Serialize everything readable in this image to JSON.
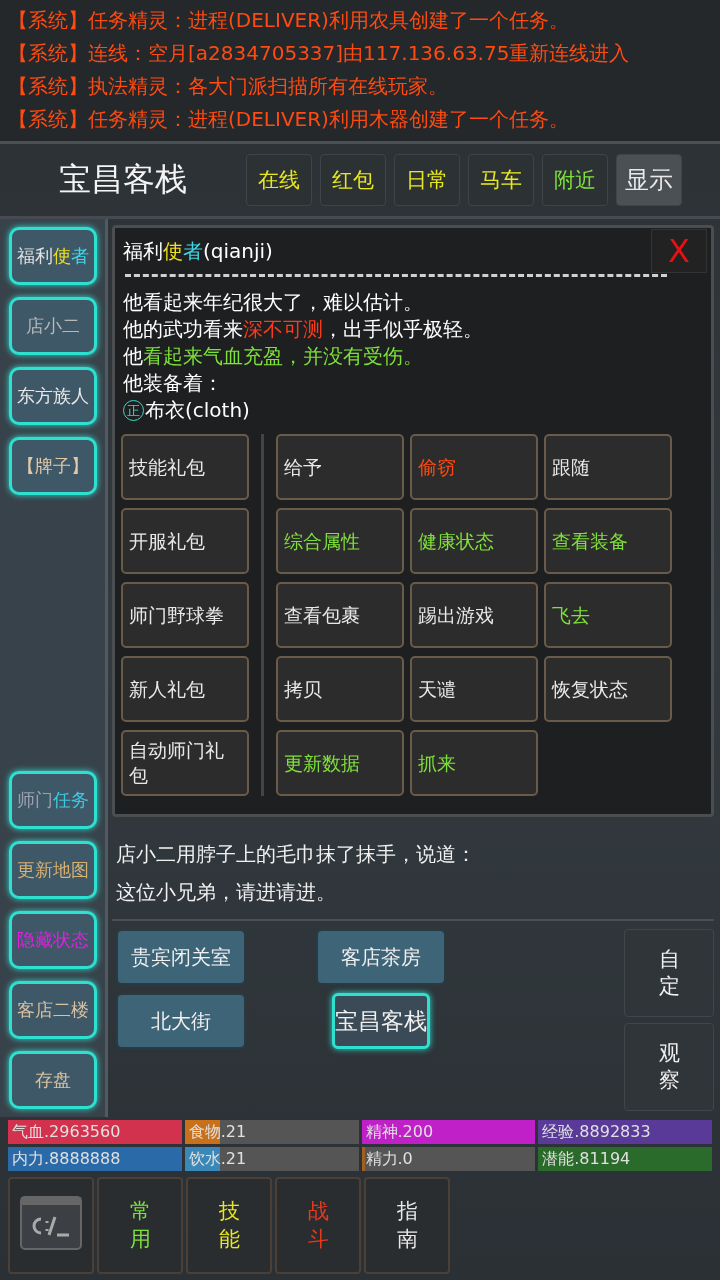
{
  "messages": [
    {
      "tag": "【系统】",
      "text": "任务精灵：进程(DELIVER)利用农具创建了一个任务。"
    },
    {
      "tag": "【系统】",
      "text": "连线：空月[a2834705337]由117.136.63.75重新连线进入"
    },
    {
      "tag": "【系统】",
      "text": "执法精灵：各大门派扫描所有在线玩家。"
    },
    {
      "tag": "【系统】",
      "text": "任务精灵：进程(DELIVER)利用木器创建了一个任务。"
    }
  ],
  "header": {
    "title": "宝昌客栈",
    "buttons": [
      {
        "label": "在线",
        "color": "#e8e820"
      },
      {
        "label": "红包",
        "color": "#e8e820"
      },
      {
        "label": "日常",
        "color": "#e8e820"
      },
      {
        "label": "马车",
        "color": "#e8e820"
      },
      {
        "label": "附近",
        "color": "#7ee03a"
      }
    ],
    "display_button": "显示"
  },
  "sidebar_top": [
    {
      "parts": [
        {
          "text": "福利",
          "color": "#e0e0e0"
        },
        {
          "text": "使",
          "color": "#f0e020"
        },
        {
          "text": "者",
          "color": "#40d8e8"
        }
      ]
    },
    {
      "parts": [
        {
          "text": "店小二",
          "color": "#b8b8b8"
        }
      ]
    },
    {
      "parts": [
        {
          "text": "东方族人",
          "color": "#e8e8e8"
        }
      ]
    },
    {
      "parts": [
        {
          "text": "【牌子】",
          "color": "#e0c8a8"
        }
      ]
    }
  ],
  "sidebar_bottom": [
    {
      "parts": [
        {
          "text": "师门",
          "color": "#9aa0b0"
        },
        {
          "text": "任务",
          "color": "#40c8e0"
        }
      ]
    },
    {
      "parts": [
        {
          "text": "更新地图",
          "color": "#d8b070"
        }
      ]
    },
    {
      "parts": [
        {
          "text": "隐藏状态",
          "color": "#e020e0"
        }
      ]
    },
    {
      "parts": [
        {
          "text": "客店二楼",
          "color": "#d8c0a0"
        }
      ]
    },
    {
      "parts": [
        {
          "text": "存盘",
          "color": "#d8c0a0"
        }
      ]
    }
  ],
  "dialog": {
    "title_parts": [
      {
        "text": "福利",
        "color": "#ffffff"
      },
      {
        "text": "使",
        "color": "#f0e020"
      },
      {
        "text": "者",
        "color": "#40d8e8"
      },
      {
        "text": "(qianji)",
        "color": "#ffffff"
      }
    ],
    "close": "X",
    "lines": [
      [
        {
          "text": "他看起来年纪很大了，难以估计。",
          "color": "#ffffff"
        }
      ],
      [
        {
          "text": "他的武功看来",
          "color": "#ffffff"
        },
        {
          "text": "深不可测",
          "color": "#ff3a1a"
        },
        {
          "text": "，出手似乎极轻。",
          "color": "#ffffff"
        }
      ],
      [
        {
          "text": "他",
          "color": "#ffffff"
        },
        {
          "text": "看起来气血充盈，并没有受伤。",
          "color": "#7ee03a"
        }
      ],
      [
        {
          "text": "他装备着：",
          "color": "#ffffff"
        }
      ]
    ],
    "equipment": {
      "badge": "正",
      "text": "布衣(cloth)"
    },
    "left_actions": [
      "技能礼包",
      "开服礼包",
      "师门野球拳",
      "新人礼包",
      "自动师门礼包"
    ],
    "actions": [
      {
        "label": "给予",
        "color": "#e8e8e8"
      },
      {
        "label": "偷窃",
        "color": "#ff4a10"
      },
      {
        "label": "跟随",
        "color": "#e8e8e8"
      },
      {
        "label": "综合属性",
        "color": "#7ee03a"
      },
      {
        "label": "健康状态",
        "color": "#7ee03a"
      },
      {
        "label": "查看装备",
        "color": "#7ee03a"
      },
      {
        "label": "查看包裹",
        "color": "#e8e8e8"
      },
      {
        "label": "踢出游戏",
        "color": "#e8e8e8"
      },
      {
        "label": "飞去",
        "color": "#7ee03a"
      },
      {
        "label": "拷贝",
        "color": "#e8e8e8"
      },
      {
        "label": "天谴",
        "color": "#e8e8e8"
      },
      {
        "label": "恢复状态",
        "color": "#e8e8e8"
      },
      {
        "label": "更新数据",
        "color": "#7ee03a"
      },
      {
        "label": "抓来",
        "color": "#7ee03a"
      }
    ]
  },
  "room_text": [
    "店小二用脖子上的毛巾抹了抹手，说道：",
    "这位小兄弟，请进请进。"
  ],
  "exits": [
    {
      "label": "贵宾闭关室",
      "selected": false
    },
    {
      "label": "客店茶房",
      "selected": false
    },
    {
      "label": "北大街",
      "selected": false
    },
    {
      "label": "宝昌客栈",
      "selected": true
    }
  ],
  "side_actions": [
    "自定",
    "观察"
  ],
  "stats": [
    {
      "label": "气血.2963560",
      "color": "#d2324e",
      "level": 1
    },
    {
      "label": "食物.21",
      "color": "#c8701a",
      "level": 0.2
    },
    {
      "label": "精神.200",
      "color": "#c020c8",
      "level": 1
    },
    {
      "label": "经验.8892833",
      "color": "#5a3a98",
      "level": 1
    },
    {
      "label": "内力.8888888",
      "color": "#2a6aa8",
      "level": 1
    },
    {
      "label": "饮水.21",
      "color": "#3a88b8",
      "level": 0.2
    },
    {
      "label": "精力.0",
      "color": "#a06020",
      "level": 0
    },
    {
      "label": "潜能.81194",
      "color": "#2a6a2a",
      "level": 1
    }
  ],
  "bottom_tabs": [
    {
      "label": "常用",
      "color": "#7ee03a"
    },
    {
      "label": "技能",
      "color": "#e8e820"
    },
    {
      "label": "战斗",
      "color": "#e83a1a"
    },
    {
      "label": "指南",
      "color": "#e8e8e8"
    }
  ]
}
